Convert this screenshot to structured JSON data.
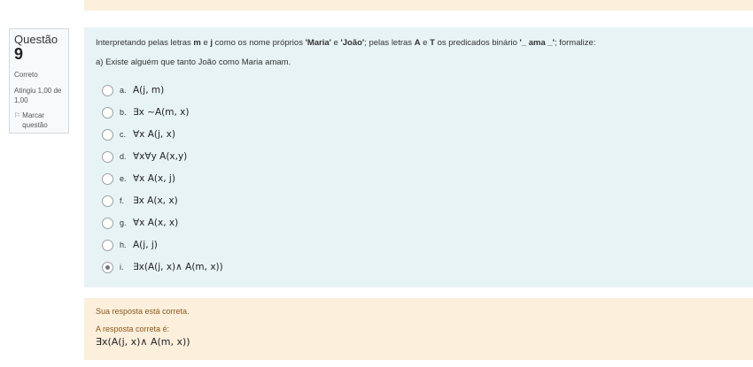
{
  "info": {
    "question_label": "Questão",
    "question_number": "9",
    "state": "Correto",
    "grade": "Atingiu 1,00 de 1,00",
    "flag_label": "Marcar questão"
  },
  "question": {
    "text_parts": {
      "p1": "Interpretando pelas letras ",
      "m": "m",
      "p2": " e ",
      "j": "j",
      "p3": " como os nome próprios ",
      "maria": "'Maria'",
      "p4": " e ",
      "joao": "'João'",
      "p5": "; pelas letras ",
      "A": "A",
      "p6": " e ",
      "T": "T",
      "p7": " os predicados binário ",
      "ama": "'_ ama _'",
      "p8": ";  formalize:"
    },
    "prompt": "a) Existe alguém que tanto João como Maria amam."
  },
  "answers": [
    {
      "letter": "a.",
      "formula": "A(j, m)",
      "checked": false
    },
    {
      "letter": "b.",
      "formula": "∃x ~A(m, x)",
      "checked": false
    },
    {
      "letter": "c.",
      "formula": "∀x A(j, x)",
      "checked": false
    },
    {
      "letter": "d.",
      "formula": "∀x∀y A(x,y)",
      "checked": false
    },
    {
      "letter": "e.",
      "formula": "∀x A(x, j)",
      "checked": false
    },
    {
      "letter": "f.",
      "formula": "∃x A(x, x)",
      "checked": false
    },
    {
      "letter": "g.",
      "formula": "∀x A(x, x)",
      "checked": false
    },
    {
      "letter": "h.",
      "formula": "A(j, j)",
      "checked": false
    },
    {
      "letter": "i.",
      "formula": "∃x(A(j, x)∧ A(m, x))",
      "checked": true
    }
  ],
  "feedback": {
    "correct_msg": "Sua resposta está correta.",
    "answer_label": "A resposta correta é:",
    "answer_formula": "∃x(A(j, x)∧ A(m, x))"
  }
}
